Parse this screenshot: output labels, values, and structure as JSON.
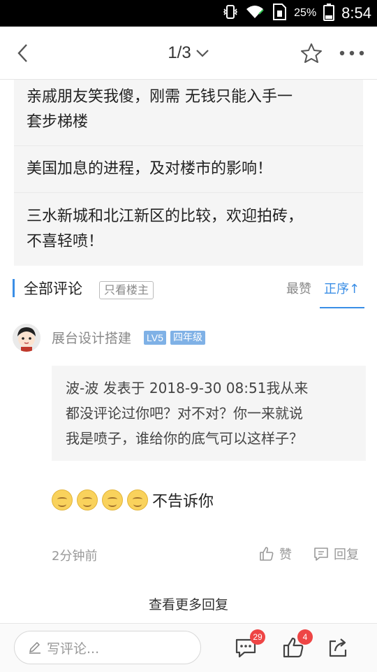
{
  "status_bar": {
    "battery_percent": "25%",
    "time": "8:54",
    "icons": [
      "vibrate-icon",
      "wifi-icon",
      "sim-icon",
      "battery-icon"
    ]
  },
  "header": {
    "pager": "1/3",
    "icons": [
      "back-icon",
      "chevron-down-icon",
      "star-icon",
      "more-icon"
    ]
  },
  "related_posts": [
    {
      "line1": "亲戚朋友笑我傻，刚需 无钱只能入手一",
      "line2": "套步梯楼"
    },
    {
      "line1": "美国加息的进程，及对楼市的影响！"
    },
    {
      "line1": "三水新城和北江新区的比较，欢迎拍砖，",
      "line2": "不喜轻喷！"
    }
  ],
  "comments_header": {
    "title": "全部评论",
    "only_op": "只看楼主",
    "sort_hot": "最赞",
    "sort_asc": "正序",
    "sort_asc_arrow": "↑",
    "accent_color": "#3a8ee6"
  },
  "comment": {
    "username": "展台设计搭建",
    "level": "LV5",
    "grade": "四年级",
    "quote_lines": [
      "波-波 发表于 2018-9-30 08:51我从来",
      "都没评论过你吧？对不对？你一来就说",
      "我是喷子，谁给你的底气可以这样子？"
    ],
    "emoji_count": 4,
    "reply_text": "不告诉你",
    "time": "2分钟前",
    "like_label": "赞",
    "reply_label": "回复"
  },
  "more_replies": "查看更多回复",
  "bottom_bar": {
    "write_placeholder": "写评论...",
    "comment_count": "29",
    "like_count": "4",
    "badge_color": "#ee4545"
  }
}
